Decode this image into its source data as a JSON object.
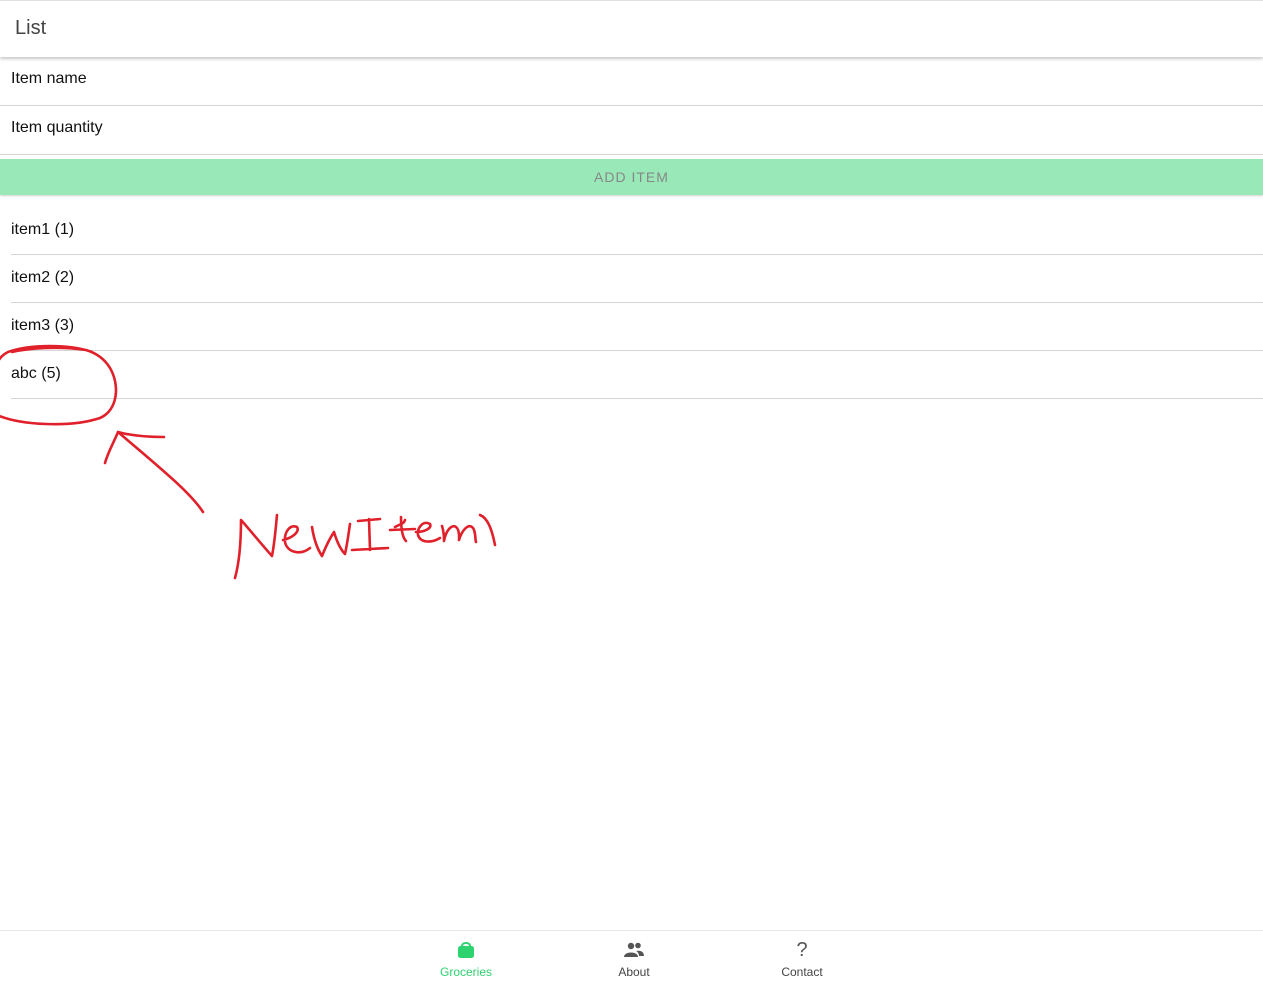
{
  "header": {
    "title": "List"
  },
  "form": {
    "name_placeholder": "Item name",
    "quantity_placeholder": "Item quantity",
    "add_button_label": "ADD ITEM"
  },
  "items": [
    {
      "label": "item1 (1)"
    },
    {
      "label": "item2 (2)"
    },
    {
      "label": "item3 (3)"
    },
    {
      "label": "abc (5)"
    }
  ],
  "annotation": {
    "text": "NewItem",
    "color": "#e0202a"
  },
  "tabs": [
    {
      "label": "Groceries",
      "icon": "shopping-bag-icon",
      "active": true
    },
    {
      "label": "About",
      "icon": "people-icon",
      "active": false
    },
    {
      "label": "Contact",
      "icon": "question-mark-icon",
      "active": false,
      "glyph": "?"
    }
  ],
  "colors": {
    "accent": "#2dd36f",
    "button_bg": "#98e8b8",
    "annotation": "#e0202a"
  }
}
